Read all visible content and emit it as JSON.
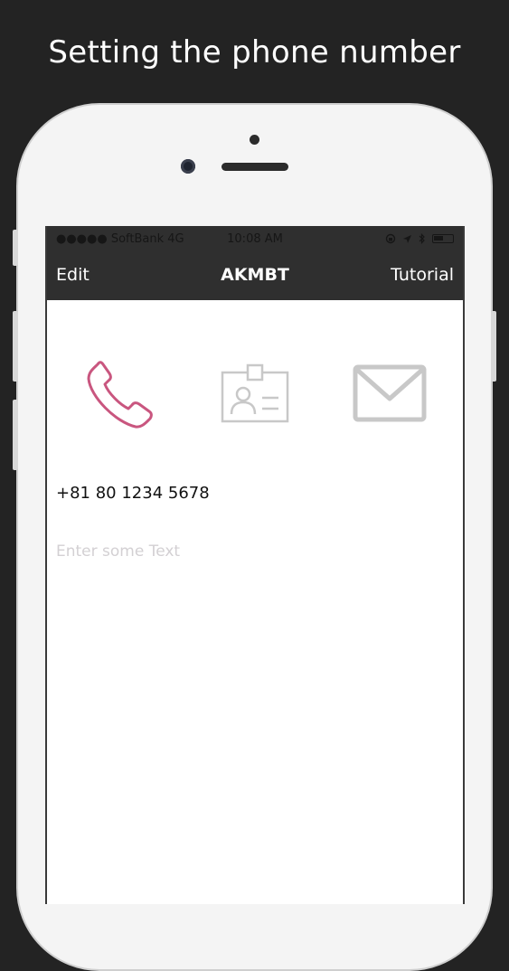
{
  "headline": "Setting the phone number",
  "status_bar": {
    "carrier": "●●●●● SoftBank  4G",
    "time": "10:08 AM",
    "battery_level": 0.5
  },
  "nav": {
    "left": "Edit",
    "title": "AKMBT",
    "right": "Tutorial"
  },
  "icons": [
    {
      "name": "phone-icon",
      "state": "selected",
      "color": "#c9567f"
    },
    {
      "name": "contact-card-icon",
      "state": "unselected",
      "color": "#c8c8c8"
    },
    {
      "name": "mail-icon",
      "state": "unselected",
      "color": "#c8c8c8"
    }
  ],
  "content": {
    "phone_number": "+81 80 1234 5678",
    "text_placeholder": "Enter some Text"
  },
  "colors": {
    "background": "#232323",
    "nav_bar": "#2f2f2f",
    "accent": "#c9567f",
    "inactive": "#c8c8c8"
  }
}
